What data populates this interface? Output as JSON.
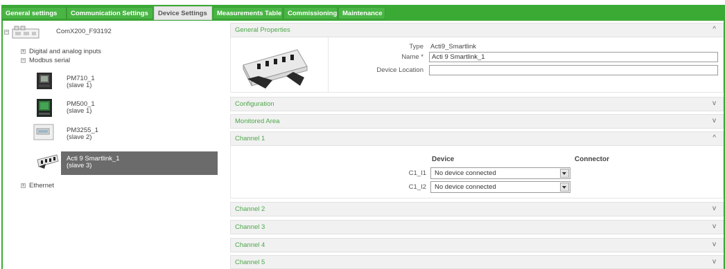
{
  "tabs": [
    {
      "label": "General settings",
      "active": false
    },
    {
      "label": "Communication Settings",
      "active": false
    },
    {
      "label": "Device Settings",
      "active": true
    },
    {
      "label": "Measurements Table",
      "active": false
    },
    {
      "label": "Commissioning",
      "active": false
    },
    {
      "label": "Maintenance",
      "active": false
    }
  ],
  "tree": {
    "root": "ComX200_F93192",
    "digital_analog": "Digital and analog inputs",
    "modbus": "Modbus serial",
    "devices": [
      {
        "name": "PM710_1",
        "slave": "(slave 1)",
        "icon": "pm710-meter-icon"
      },
      {
        "name": "PM500_1",
        "slave": "(slave 1)",
        "icon": "pm500-meter-icon"
      },
      {
        "name": "PM3255_1",
        "slave": "(slave 2)",
        "icon": "pm3255-meter-icon"
      },
      {
        "name": "Acti 9 Smartlink_1",
        "slave": "(slave 3)",
        "icon": "smartlink-icon",
        "selected": true
      }
    ],
    "ethernet": "Ethernet"
  },
  "general": {
    "title": "General Properties",
    "type_label": "Type",
    "type_value": "Acti9_Smartlink",
    "name_label": "Name *",
    "name_value": "Acti 9 Smartlink_1",
    "location_label": "Device Location",
    "location_value": ""
  },
  "sections": {
    "configuration": "Configuration",
    "monitored_area": "Monitored Area",
    "channel1": "Channel 1",
    "channel2": "Channel 2",
    "channel3": "Channel 3",
    "channel4": "Channel 4",
    "channel5": "Channel 5"
  },
  "channel1": {
    "device_header": "Device",
    "connector_header": "Connector",
    "rows": [
      {
        "label": "C1_I1",
        "value": "No device connected"
      },
      {
        "label": "C1_I2",
        "value": "No device connected"
      }
    ]
  },
  "colors": {
    "accent": "#3aaa35",
    "section_title": "#4da64a",
    "selected": "#6b6b6b"
  }
}
